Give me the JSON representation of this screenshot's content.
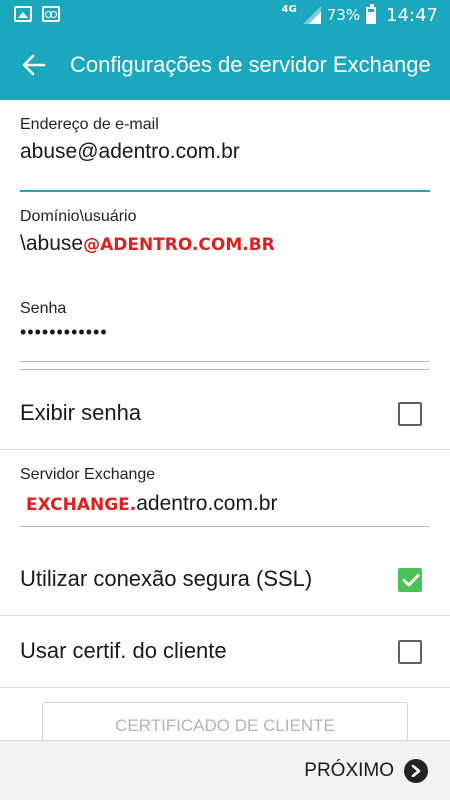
{
  "status_bar": {
    "network": "4G",
    "battery": "73%",
    "time": "14:47",
    "icons": [
      "image-icon",
      "voicemail-icon",
      "signal-icon",
      "battery-icon"
    ]
  },
  "app_bar": {
    "title": "Configurações de servidor Exchange",
    "back_icon": "arrow-left-icon"
  },
  "form": {
    "email": {
      "label": "Endereço de e-mail",
      "value": "abuse@adentro.com.br"
    },
    "domain_user": {
      "label": "Domínio\\usuário",
      "value_plain": "\\abuse",
      "value_red": "@ADENTRO.COM.BR"
    },
    "password": {
      "label": "Senha",
      "value": "••••••••••••"
    },
    "show_password": {
      "label": "Exibir senha",
      "checked": false
    },
    "exchange_server": {
      "label": "Servidor Exchange",
      "value_red": "EXCHANGE.",
      "value_plain": "adentro.com.br"
    },
    "ssl": {
      "label": "Utilizar conexão segura (SSL)",
      "checked": true
    },
    "client_cert": {
      "label": "Usar certif. do cliente",
      "checked": false
    },
    "client_cert_button": "CERTIFICADO DE CLIENTE"
  },
  "footer": {
    "next_label": "PRÓXIMO",
    "next_icon": "chevron-right-circle-icon"
  },
  "colors": {
    "accent": "#1ba7bd",
    "check_green": "#4cc159",
    "annotation_red": "#e0201e"
  }
}
